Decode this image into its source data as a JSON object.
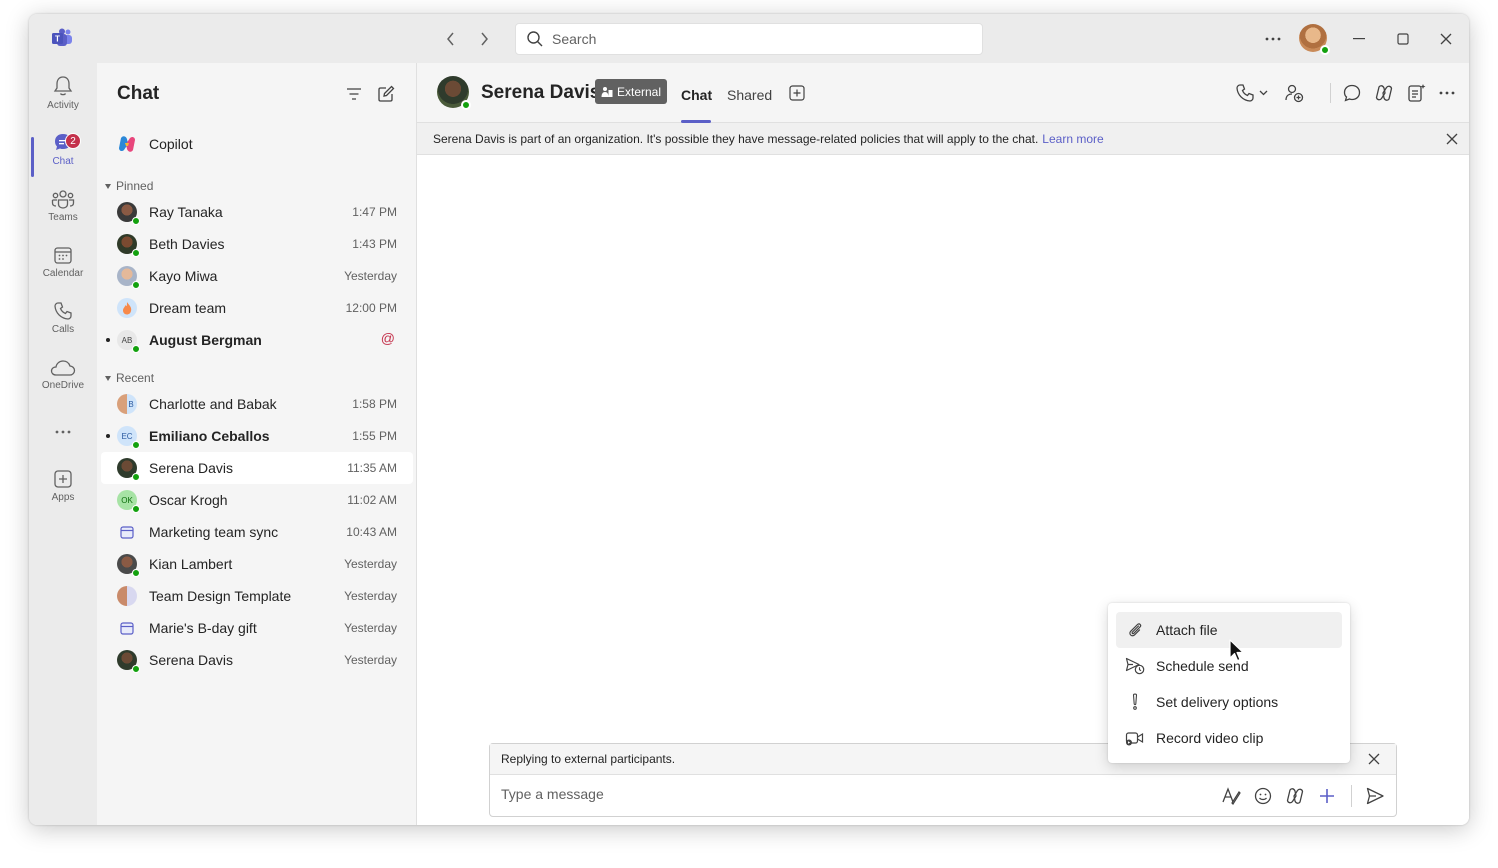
{
  "app": {
    "title": "Microsoft Teams"
  },
  "search": {
    "placeholder": "Search"
  },
  "titlebar": {
    "more_label": "...",
    "minimize": "minimize",
    "maximize": "maximize",
    "close": "close"
  },
  "rail": {
    "items": [
      {
        "label": "Activity",
        "icon": "bell-icon"
      },
      {
        "label": "Chat",
        "icon": "chat-icon",
        "badge": "2"
      },
      {
        "label": "Teams",
        "icon": "teams-icon"
      },
      {
        "label": "Calendar",
        "icon": "calendar-icon"
      },
      {
        "label": "Calls",
        "icon": "phone-icon"
      },
      {
        "label": "OneDrive",
        "icon": "cloud-icon"
      },
      {
        "label": "...",
        "icon": "more-icon"
      },
      {
        "label": "Apps",
        "icon": "add-app-icon"
      }
    ]
  },
  "chatlist": {
    "title": "Chat",
    "copilot": "Copilot",
    "pinned_label": "Pinned",
    "recent_label": "Recent",
    "pinned": [
      {
        "name": "Ray Tanaka",
        "time": "1:47 PM"
      },
      {
        "name": "Beth Davies",
        "time": "1:43 PM"
      },
      {
        "name": "Kayo Miwa",
        "time": "Yesterday"
      },
      {
        "name": "Dream team",
        "time": "12:00 PM"
      },
      {
        "name": "August Bergman",
        "time": "",
        "initials": "AB",
        "mention": "@"
      }
    ],
    "recent": [
      {
        "name": "Charlotte and Babak",
        "time": "1:58 PM",
        "initials": "B"
      },
      {
        "name": "Emiliano Ceballos",
        "time": "1:55 PM",
        "initials": "EC"
      },
      {
        "name": "Serena Davis",
        "time": "11:35 AM"
      },
      {
        "name": "Oscar Krogh",
        "time": "11:02 AM",
        "initials": "OK"
      },
      {
        "name": "Marketing team sync",
        "time": "10:43 AM"
      },
      {
        "name": "Kian Lambert",
        "time": "Yesterday"
      },
      {
        "name": "Team Design Template",
        "time": "Yesterday"
      },
      {
        "name": "Marie's B-day gift",
        "time": "Yesterday"
      },
      {
        "name": "Serena Davis",
        "time": "Yesterday"
      }
    ]
  },
  "conversation": {
    "name": "Serena Davis",
    "external_badge": "External",
    "tabs": [
      "Chat",
      "Shared"
    ],
    "banner_text": "Serena Davis is part of an organization. It's possible they have message-related policies that will apply to the chat.",
    "banner_link": "Learn more",
    "reply_notice": "Replying to external participants.",
    "input_placeholder": "Type a message"
  },
  "attach_menu": {
    "items": [
      {
        "label": "Attach file",
        "icon": "paperclip-icon"
      },
      {
        "label": "Schedule send",
        "icon": "schedule-send-icon"
      },
      {
        "label": "Set delivery options",
        "icon": "exclamation-icon"
      },
      {
        "label": "Record video clip",
        "icon": "video-clip-icon"
      }
    ]
  },
  "colors": {
    "accent": "#5b5fc7",
    "presence": "#13a10e",
    "badge": "#c4314b",
    "mention": "#c4314b"
  }
}
